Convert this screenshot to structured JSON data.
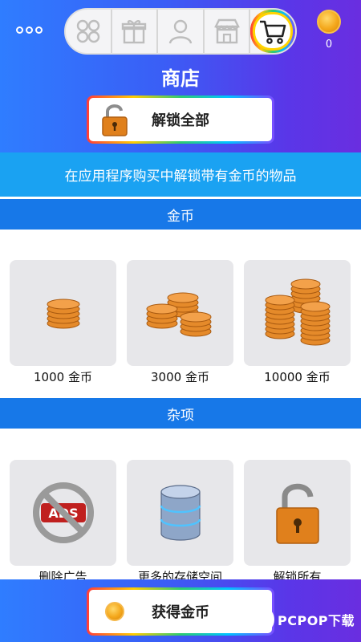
{
  "header": {
    "title": "商店",
    "coin_count": "0",
    "unlock_label": "解锁全部"
  },
  "tabs": [
    {
      "name": "grid",
      "icon": "grid-icon",
      "active": false
    },
    {
      "name": "gift",
      "icon": "gift-icon",
      "active": false
    },
    {
      "name": "profile",
      "icon": "person-icon",
      "active": false
    },
    {
      "name": "store",
      "icon": "storefront-icon",
      "active": false
    },
    {
      "name": "cart",
      "icon": "cart-icon",
      "active": true
    }
  ],
  "promo_text": "在应用程序购买中解锁带有金币的物品",
  "sections": {
    "coins": {
      "title": "金币",
      "items": [
        {
          "label": "1000 金币",
          "icon": "coin-stack-small-icon"
        },
        {
          "label": "3000 金币",
          "icon": "coin-stack-medium-icon"
        },
        {
          "label": "10000 金币",
          "icon": "coin-stack-large-icon"
        }
      ]
    },
    "misc": {
      "title": "杂项",
      "items": [
        {
          "label": "删除广告",
          "icon": "no-ads-icon"
        },
        {
          "label": "更多的存储空间",
          "icon": "database-icon"
        },
        {
          "label": "解锁所有",
          "icon": "padlock-icon"
        }
      ]
    }
  },
  "bottom": {
    "earn_label": "获得金币"
  },
  "watermark": {
    "logo": "P",
    "text": "PCPOP下载"
  },
  "colors": {
    "header_gradient_start": "#2f7dff",
    "header_gradient_end": "#6a2ee0",
    "promo_bg": "#1aa2f2",
    "section_bg": "#1778e8",
    "card_bg": "#e7e7ea",
    "coin_orange": "#e07f1f"
  }
}
